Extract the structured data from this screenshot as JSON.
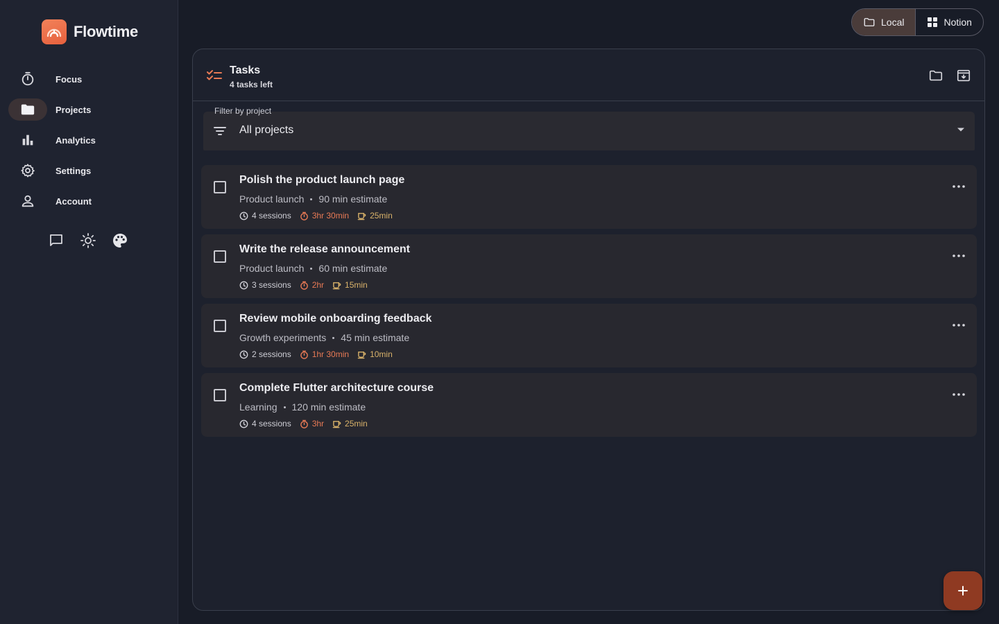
{
  "app": {
    "name": "Flowtime"
  },
  "sidebar": {
    "items": [
      {
        "label": "Focus",
        "icon": "timer-icon",
        "active": false
      },
      {
        "label": "Projects",
        "icon": "folder-icon",
        "active": true
      },
      {
        "label": "Analytics",
        "icon": "bar-chart-icon",
        "active": false
      },
      {
        "label": "Settings",
        "icon": "gear-icon",
        "active": false
      },
      {
        "label": "Account",
        "icon": "person-icon",
        "active": false
      }
    ],
    "tools": [
      "feedback-icon",
      "brightness-icon",
      "palette-icon"
    ]
  },
  "source_toggle": {
    "options": [
      {
        "label": "Local",
        "icon": "folder-outline-icon",
        "selected": true
      },
      {
        "label": "Notion",
        "icon": "grid-icon",
        "selected": false
      }
    ]
  },
  "panel": {
    "title": "Tasks",
    "subtitle": "4 tasks left",
    "filter": {
      "label": "Filter by project",
      "value": "All projects"
    }
  },
  "tasks": [
    {
      "title": "Polish the product launch page",
      "project": "Product launch",
      "estimate": "90 min estimate",
      "sessions": "4 sessions",
      "work": "3hr 30min",
      "break": "25min",
      "done": false
    },
    {
      "title": "Write the release announcement",
      "project": "Product launch",
      "estimate": "60 min estimate",
      "sessions": "3 sessions",
      "work": "2hr",
      "break": "15min",
      "done": false
    },
    {
      "title": "Review mobile onboarding feedback",
      "project": "Growth experiments",
      "estimate": "45 min estimate",
      "sessions": "2 sessions",
      "work": "1hr 30min",
      "break": "10min",
      "done": false
    },
    {
      "title": "Complete Flutter architecture course",
      "project": "Learning",
      "estimate": "120 min estimate",
      "sessions": "4 sessions",
      "work": "3hr",
      "break": "25min",
      "done": false
    }
  ],
  "colors": {
    "accent": "#e87a55",
    "break": "#d9b26a",
    "fab": "#8f3a22",
    "background": "#181c27",
    "sidebar": "#1f2330"
  }
}
